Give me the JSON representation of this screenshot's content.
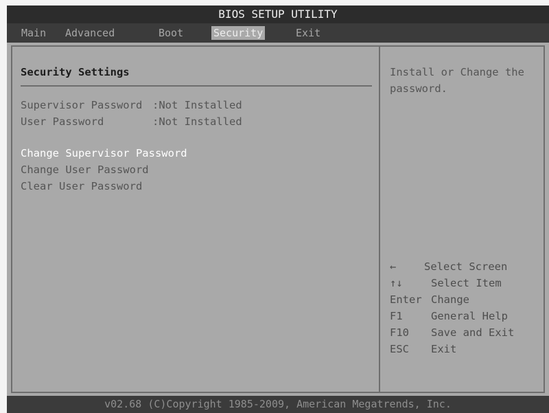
{
  "title": "BIOS SETUP UTILITY",
  "menu": {
    "tabs": [
      {
        "label": "Main"
      },
      {
        "label": "Advanced"
      },
      {
        "label": "Boot"
      },
      {
        "label": "Security"
      },
      {
        "label": "Exit"
      }
    ],
    "active": "Security"
  },
  "main": {
    "section_title": "Security Settings",
    "fields": [
      {
        "label": "Supervisor Password",
        "value": ":Not Installed"
      },
      {
        "label": "User Password",
        "value": ":Not Installed"
      }
    ],
    "options": [
      {
        "label": "Change Supervisor Password",
        "selected": true
      },
      {
        "label": "Change User Password",
        "selected": false
      },
      {
        "label": "Clear User Password",
        "selected": false
      }
    ]
  },
  "help": {
    "lines": [
      "Install or Change the",
      "password."
    ],
    "keys": [
      {
        "key": "←",
        "action": "Select Screen"
      },
      {
        "key": "↑↓",
        "action": "Select Item"
      },
      {
        "key": "Enter",
        "action": "Change"
      },
      {
        "key": "F1",
        "action": "General Help"
      },
      {
        "key": "F10",
        "action": "Save and Exit"
      },
      {
        "key": "ESC",
        "action": "Exit"
      }
    ]
  },
  "footer": "v02.68 (C)Copyright 1985-2009, American Megatrends, Inc.",
  "colors": {
    "background": "#a9a9a9",
    "bar": "#3b3b3b",
    "selected_text": "#ffffff",
    "normal_text": "#555555"
  }
}
